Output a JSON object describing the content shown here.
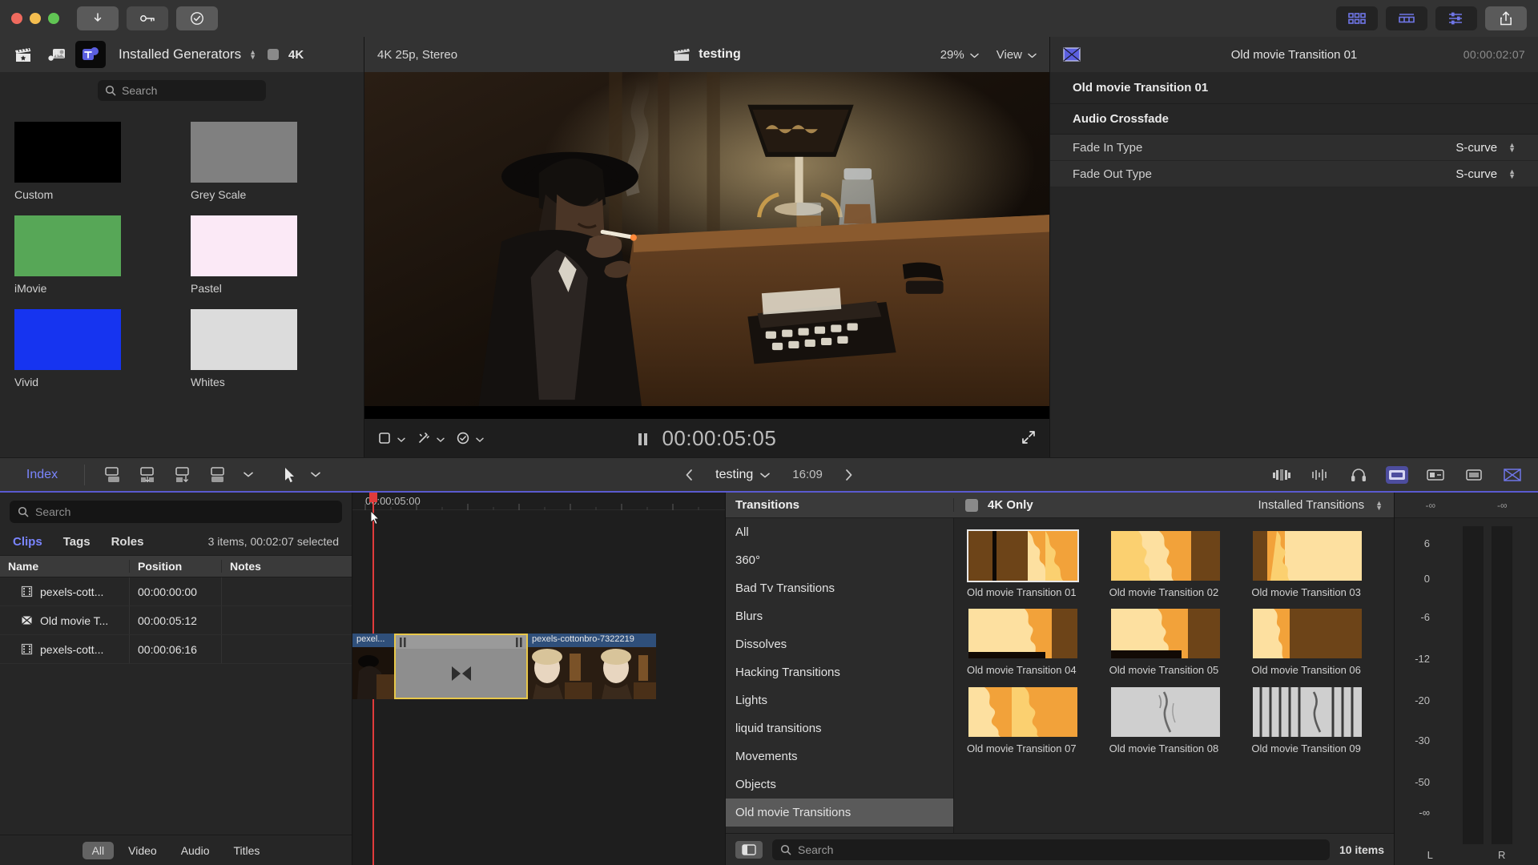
{
  "titlebar": {
    "buttons": [
      {
        "name": "download-button",
        "icon": "download-icon"
      },
      {
        "name": "keyframe-button",
        "icon": "key-icon"
      },
      {
        "name": "validate-button",
        "icon": "check-circle-icon"
      }
    ],
    "right_buttons": [
      {
        "name": "browser-toggle",
        "icon": "grid-icon"
      },
      {
        "name": "timeline-toggle",
        "icon": "timeline-icon"
      },
      {
        "name": "inspector-toggle",
        "icon": "sliders-icon"
      },
      {
        "name": "share-button",
        "icon": "share-icon"
      }
    ]
  },
  "browser": {
    "tabs": [
      {
        "name": "photos-audio-tab",
        "icon": "clapperboard-star-icon",
        "active": false
      },
      {
        "name": "music-tab",
        "icon": "music-photo-icon",
        "active": false
      },
      {
        "name": "titles-generators-tab",
        "icon": "titles-icon",
        "active": true
      }
    ],
    "title": "Installed Generators",
    "fourk_label": "4K",
    "search_placeholder": "Search",
    "generators": [
      {
        "label": "Custom",
        "color": "#000000"
      },
      {
        "label": "Grey Scale",
        "color": "#808080"
      },
      {
        "label": "iMovie",
        "color": "#57a757"
      },
      {
        "label": "Pastel",
        "color": "#fbe9f6"
      },
      {
        "label": "Vivid",
        "color": "#1634f0"
      },
      {
        "label": "Whites",
        "color": "#dcdcdc"
      }
    ]
  },
  "viewer": {
    "format": "4K 25p, Stereo",
    "project": "testing",
    "zoom": "29%",
    "view_label": "View",
    "timecode": "00:00:05:05",
    "transport_state": "paused"
  },
  "inspector": {
    "title": "Old movie Transition 01",
    "timecode": "00:00:02:07",
    "icon": "transition-icon",
    "section_title": "Old movie Transition 01",
    "subsection": "Audio Crossfade",
    "rows": [
      {
        "label": "Fade In Type",
        "value": "S-curve"
      },
      {
        "label": "Fade Out Type",
        "value": "S-curve"
      }
    ]
  },
  "timeline_toolbar": {
    "index_label": "Index",
    "project": "testing",
    "duration": "16:09",
    "tools": [
      "append-icon",
      "insert-icon",
      "overwrite-icon",
      "connect-icon"
    ],
    "right_tools": [
      "audio-meters-icon",
      "waveform-icon",
      "headphones-icon",
      "color-icon",
      "video-icon",
      "render-icon",
      "transitions-icon"
    ]
  },
  "index": {
    "search_placeholder": "Search",
    "tabs": [
      {
        "label": "Clips",
        "active": true
      },
      {
        "label": "Tags",
        "active": false
      },
      {
        "label": "Roles",
        "active": false
      }
    ],
    "summary": "3 items, 00:02:07 selected",
    "columns": [
      "Name",
      "Position",
      "Notes"
    ],
    "rows": [
      {
        "icon": "filmstrip-icon",
        "name": "pexels-cott...",
        "position": "00:00:00:00",
        "notes": ""
      },
      {
        "icon": "transition-icon",
        "name": "Old movie T...",
        "position": "00:00:05:12",
        "notes": ""
      },
      {
        "icon": "filmstrip-icon",
        "name": "pexels-cott...",
        "position": "00:00:06:16",
        "notes": ""
      }
    ],
    "filters": [
      {
        "label": "All",
        "active": true
      },
      {
        "label": "Video",
        "active": false
      },
      {
        "label": "Audio",
        "active": false
      },
      {
        "label": "Titles",
        "active": false
      }
    ]
  },
  "timeline": {
    "ruler_timecode": "00:00:05:00",
    "clips": [
      {
        "name": "pexel...",
        "type": "video"
      },
      {
        "name": "pexels-cottonbro-7322219",
        "type": "video"
      }
    ],
    "transition_name": "Old movie Transition 01"
  },
  "transitions": {
    "header": "Transitions",
    "fourk_only_label": "4K Only",
    "installed_label": "Installed Transitions",
    "categories": [
      {
        "label": "All",
        "active": false
      },
      {
        "label": "360°",
        "active": false
      },
      {
        "label": "Bad Tv Transitions",
        "active": false
      },
      {
        "label": "Blurs",
        "active": false
      },
      {
        "label": "Dissolves",
        "active": false
      },
      {
        "label": "Hacking Transitions",
        "active": false
      },
      {
        "label": "Lights",
        "active": false
      },
      {
        "label": "liquid transitions",
        "active": false
      },
      {
        "label": "Movements",
        "active": false
      },
      {
        "label": "Objects",
        "active": false
      },
      {
        "label": "Old movie Transitions",
        "active": true
      }
    ],
    "items": [
      {
        "label": "Old movie Transition 01",
        "style": "burn-left",
        "selected": true
      },
      {
        "label": "Old movie Transition 02",
        "style": "burn-center",
        "selected": false
      },
      {
        "label": "Old movie Transition 03",
        "style": "burn-center2",
        "selected": false
      },
      {
        "label": "Old movie Transition 04",
        "style": "burn-wide",
        "selected": false
      },
      {
        "label": "Old movie Transition 05",
        "style": "burn-wide2",
        "selected": false
      },
      {
        "label": "Old movie Transition 06",
        "style": "burn-right",
        "selected": false
      },
      {
        "label": "Old movie Transition 07",
        "style": "burn-full",
        "selected": false
      },
      {
        "label": "Old movie Transition 08",
        "style": "scratch-light",
        "selected": false
      },
      {
        "label": "Old movie Transition 09",
        "style": "scratch-dark",
        "selected": false
      }
    ],
    "footer_search_placeholder": "Search",
    "item_count": "10 items"
  },
  "meters": {
    "top_labels": [
      "-∞",
      "-∞"
    ],
    "ticks": [
      "6",
      "0",
      "-6",
      "-12",
      "-20",
      "-30",
      "-50",
      "-∞"
    ],
    "channels": [
      "L",
      "R"
    ]
  }
}
